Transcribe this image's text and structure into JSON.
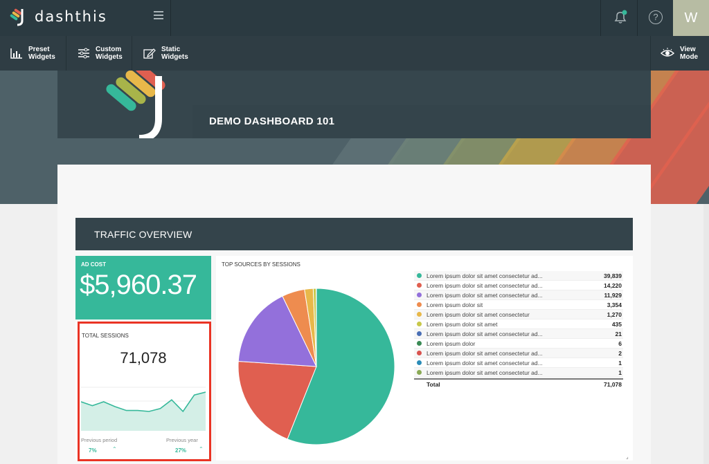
{
  "app": {
    "name": "dashthis",
    "avatar_initial": "W"
  },
  "toolbar": {
    "preset": {
      "line1": "Preset",
      "line2": "Widgets",
      "icon": "bar-chart-icon"
    },
    "custom": {
      "line1": "Custom",
      "line2": "Widgets",
      "icon": "sliders-icon"
    },
    "static": {
      "line1": "Static",
      "line2": "Widgets",
      "icon": "edit-icon"
    },
    "view": {
      "line1": "View",
      "line2": "Mode",
      "icon": "eye-icon"
    }
  },
  "dashboard": {
    "title": "DEMO DASHBOARD 101"
  },
  "section": {
    "title": "TRAFFIC OVERVIEW"
  },
  "ad_cost": {
    "label": "AD COST",
    "value": "$5,960.37"
  },
  "sessions": {
    "label": "TOTAL SESSIONS",
    "value": "71,078",
    "previous_period_label": "Previous period",
    "previous_period_value": "7%",
    "previous_year_label": "Previous year",
    "previous_year_value": "27%",
    "sparkline": [
      30,
      26,
      30,
      25,
      21,
      21,
      20,
      23,
      32,
      20,
      37,
      40
    ]
  },
  "sources": {
    "label": "TOP SOURCES BY SESSIONS",
    "rows": [
      {
        "name": "Lorem ipsum dolor sit amet consectetur ad...",
        "value": "39,839",
        "num": 39839,
        "color": "#36b89a"
      },
      {
        "name": "Lorem ipsum dolor sit amet consectetur ad...",
        "value": "14,220",
        "num": 14220,
        "color": "#e05f50"
      },
      {
        "name": "Lorem ipsum dolor sit amet consectetur ad...",
        "value": "11,929",
        "num": 11929,
        "color": "#9370db"
      },
      {
        "name": "Lorem ipsum dolor sit",
        "value": "3,354",
        "num": 3354,
        "color": "#ee8c4f"
      },
      {
        "name": "Lorem ipsum dolor sit amet consectetur",
        "value": "1,270",
        "num": 1270,
        "color": "#e8b84a"
      },
      {
        "name": "Lorem ipsum dolor sit amet",
        "value": "435",
        "num": 435,
        "color": "#c8c84a"
      },
      {
        "name": "Lorem ipsum dolor sit amet consectetur ad...",
        "value": "21",
        "num": 21,
        "color": "#4a6fb5"
      },
      {
        "name": "Lorem ipsum dolor",
        "value": "6",
        "num": 6,
        "color": "#3a8a55"
      },
      {
        "name": "Lorem ipsum dolor sit amet consectetur ad...",
        "value": "2",
        "num": 2,
        "color": "#d9534f"
      },
      {
        "name": "Lorem ipsum dolor sit amet consectetur ad...",
        "value": "1",
        "num": 1,
        "color": "#2a8cb8"
      },
      {
        "name": "Lorem ipsum dolor sit amet consectetur ad...",
        "value": "1",
        "num": 1,
        "color": "#8aaa55"
      }
    ],
    "total_label": "Total",
    "total_value": "71,078"
  }
}
